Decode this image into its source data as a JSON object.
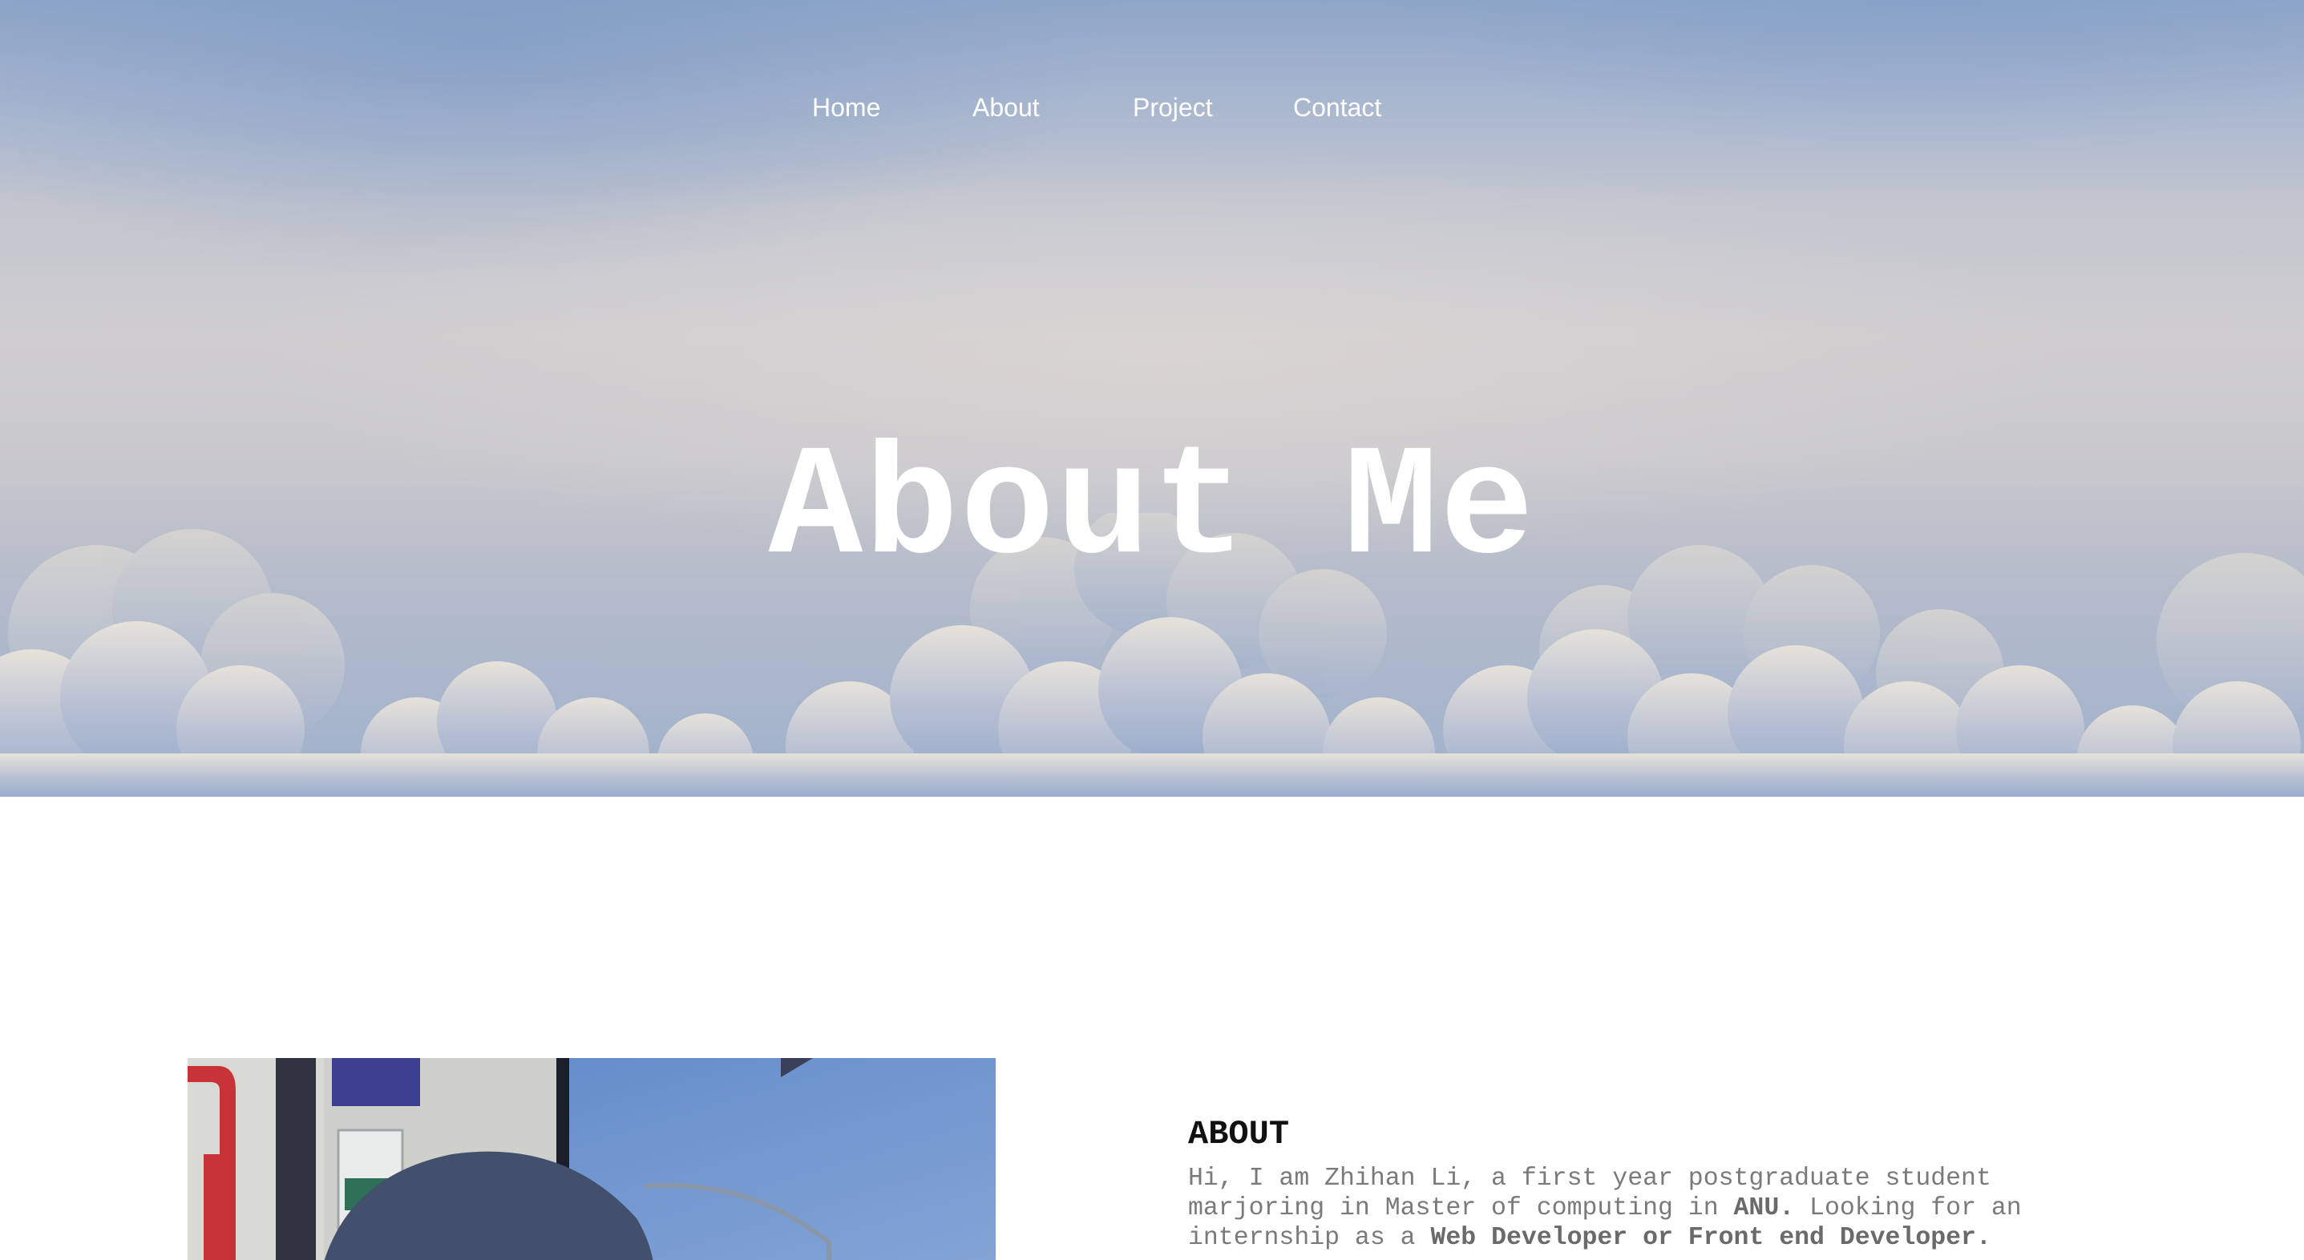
{
  "nav": {
    "items": [
      {
        "label": "Home"
      },
      {
        "label": "About"
      },
      {
        "label": "Project"
      },
      {
        "label": "Contact"
      }
    ]
  },
  "hero": {
    "title": "About Me"
  },
  "about": {
    "heading": "ABOUT",
    "text_part1": "Hi, I am Zhihan Li, a first year postgraduate student marjoring in Master of computing in ",
    "text_bold1": "ANU.",
    "text_part2": " Looking for an internship as a ",
    "text_bold2": "Web Developer or Front end Developer."
  },
  "colors": {
    "nav_text": "#ffffff",
    "hero_title": "#ffffff",
    "heading": "#111111",
    "body_text": "#7a7a7a"
  }
}
